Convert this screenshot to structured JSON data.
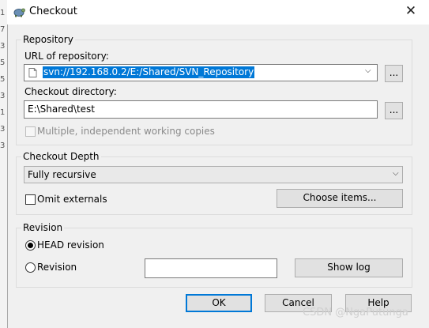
{
  "window": {
    "title": "Checkout",
    "close_glyph": "✕"
  },
  "background_lines": [
    "1",
    "7",
    "3",
    "5",
    "5",
    "3",
    "1",
    "3",
    "3"
  ],
  "repository": {
    "group_label": "Repository",
    "url_label": "URL of repository:",
    "url_value": "svn://192.168.0.2/E:/Shared/SVN_Repository",
    "url_browse": "...",
    "dir_label": "Checkout directory:",
    "dir_value": "E:\\Shared\\test",
    "dir_browse": "...",
    "multiple_label": "Multiple, independent working copies"
  },
  "depth": {
    "group_label": "Checkout Depth",
    "selected": "Fully recursive",
    "omit_label": "Omit externals",
    "choose_items": "Choose items..."
  },
  "revision": {
    "group_label": "Revision",
    "head_label": "HEAD revision",
    "rev_label": "Revision",
    "rev_value": "",
    "show_log": "Show log"
  },
  "buttons": {
    "ok": "OK",
    "cancel": "Cancel",
    "help": "Help"
  },
  "watermark": "CSDN @NgaPutunga",
  "colors": {
    "accent": "#0078d7",
    "dialog_bg": "#f0f0f0"
  }
}
